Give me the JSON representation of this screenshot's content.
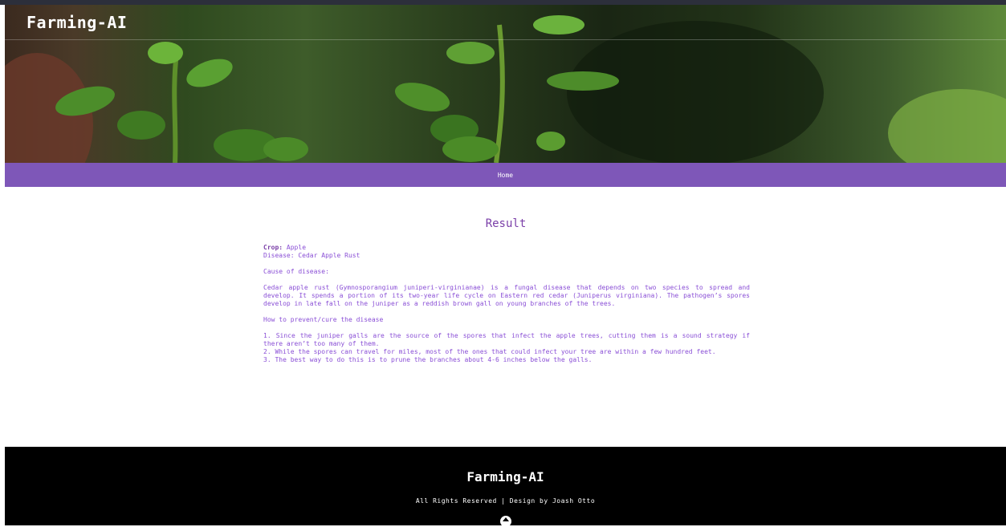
{
  "header": {
    "site_title": "Farming-AI"
  },
  "nav": {
    "home_label": "Home"
  },
  "result": {
    "heading": "Result",
    "crop_label": "Crop:",
    "crop_value": "Apple",
    "disease_line": "Disease: Cedar Apple Rust",
    "cause_heading": "Cause of disease:",
    "cause_text": "Cedar apple rust (Gymnosporangium juniperi-virginianae) is a fungal disease that depends on two species to spread and develop. It spends a portion of its two-year life cycle on Eastern red cedar (Juniperus virginiana). The pathogen’s spores develop in late fall on the juniper as a reddish brown gall on young branches of the trees.",
    "prevent_heading": "How to prevent/cure the disease",
    "steps": [
      "1. Since the juniper galls are the source of the spores that infect the apple trees, cutting them is a sound strategy if there aren’t too many of them.",
      "2. While the spores can travel for miles, most of the ones that could infect your tree are within a few hundred feet.",
      "3. The best way to do this is to prune the branches about 4-6 inches below the galls."
    ]
  },
  "footer": {
    "title": "Farming-AI",
    "copyright": "All Rights Reserved | Design by Joash Otto"
  }
}
